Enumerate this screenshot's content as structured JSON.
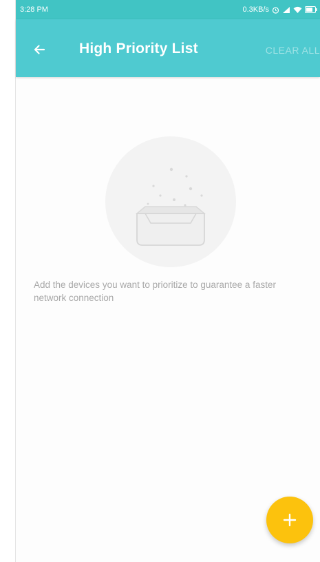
{
  "status_bar": {
    "time": "3:28 PM",
    "network_speed": "0.3KB/s",
    "icons": [
      "alarm-icon",
      "signal-icon",
      "wifi-icon",
      "battery-icon"
    ]
  },
  "app_bar": {
    "title": "High Priority List",
    "back_icon": "arrow-back-icon",
    "clear_all_label": "CLEAR ALL"
  },
  "empty_state": {
    "illustration": "empty-inbox-icon",
    "message": "Add the devices you want to prioritize to guarantee a faster network connection"
  },
  "fab": {
    "icon": "plus-icon"
  },
  "colors": {
    "status_bar": "#41c4c4",
    "app_bar": "#4fcad0",
    "fab": "#fcc20d",
    "message_text": "#a8a8a8"
  }
}
